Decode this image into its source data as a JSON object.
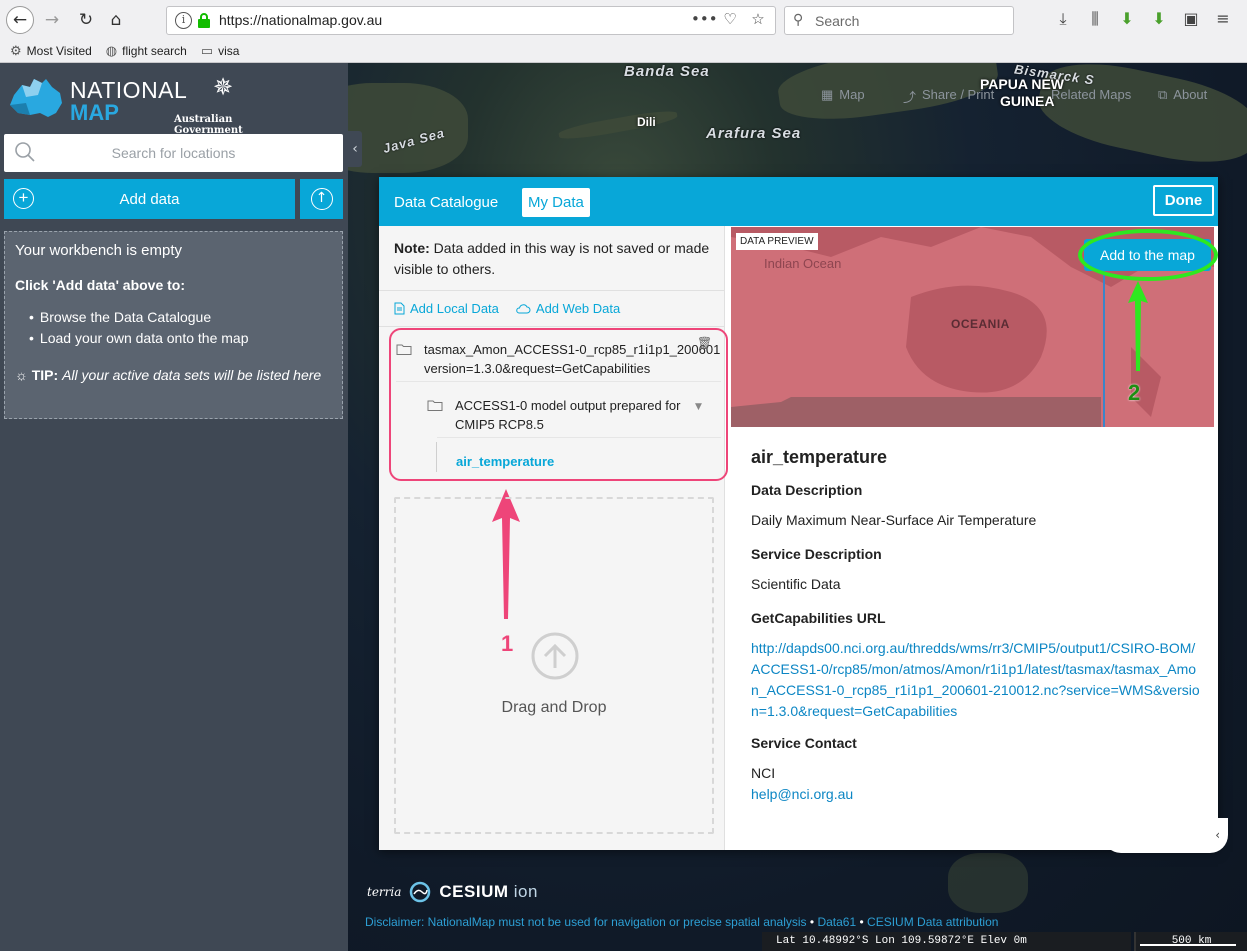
{
  "browser": {
    "url": "https://nationalmap.gov.au",
    "search_placeholder": "Search",
    "bookmarks": [
      {
        "label": "Most Visited",
        "icon": "gear-icon"
      },
      {
        "label": "flight search",
        "icon": "globe-icon"
      },
      {
        "label": "visa",
        "icon": "folder-icon"
      }
    ]
  },
  "map": {
    "labels": [
      "Banda Sea",
      "Arafura Sea",
      "Java Sea",
      "Bismarck S"
    ],
    "places": [
      "PAPUA NEW",
      "GUINEA",
      "Dili"
    ],
    "menu": [
      "Map",
      "Share / Print",
      "Related Maps",
      "About"
    ]
  },
  "workbench": {
    "logo_line1": "NATIONAL",
    "logo_line2": "MAP",
    "gov_text": "Australian Government",
    "search_placeholder": "Search for locations",
    "add_data_label": "Add data",
    "empty_title": "Your workbench is empty",
    "empty_sub": "Click 'Add data' above to:",
    "empty_items": [
      "Browse the Data Catalogue",
      "Load your own data onto the map"
    ],
    "tip_label": "TIP:",
    "tip_text": "All your active data sets will be listed here"
  },
  "modal": {
    "tab_catalogue": "Data Catalogue",
    "tab_mydata": "My Data",
    "done_label": "Done",
    "note_label": "Note:",
    "note_text": "Data added in this way is not saved or made visible to others.",
    "add_local": "Add Local Data",
    "add_web": "Add Web Data",
    "tree_root": "tasmax_Amon_ACCESS1-0_rcp85_r1i1p1_200601 version=1.3.0&request=GetCapabilities",
    "tree_child": "ACCESS1-0 model output prepared for CMIP5 RCP8.5",
    "tree_leaf": "air_temperature",
    "drop_text": "Drag and Drop",
    "annotation_1": "1",
    "annotation_2": "2",
    "preview_label": "DATA PREVIEW",
    "preview_ocean": "Indian Ocean",
    "preview_oceania": "OCEANIA",
    "add_to_map": "Add to the map",
    "details": {
      "title": "air_temperature",
      "data_desc_head": "Data Description",
      "data_desc": "Daily Maximum Near-Surface Air Temperature",
      "service_desc_head": "Service Description",
      "service_desc": "Scientific Data",
      "getcap_head": "GetCapabilities URL",
      "getcap_url": "http://dapds00.nci.org.au/thredds/wms/rr3/CMIP5/output1/CSIRO-BOM/ACCESS1-0/rcp85/mon/atmos/Amon/r1i1p1/latest/tasmax/tasmax_Amon_ACCESS1-0_rcp85_r1i1p1_200601-210012.nc?service=WMS&version=1.3.0&request=GetCapabilities",
      "contact_head": "Service Contact",
      "contact_name": "NCI",
      "contact_email": "help@nci.org.au"
    }
  },
  "footer": {
    "terria": "terria",
    "cesium": "CESIUM",
    "ion": "ion",
    "disclaimer": "Disclaimer: NationalMap must not be used for navigation or precise spatial analysis",
    "data61": "Data61",
    "cesium_link": "CESIUM",
    "attribution": "Data attribution",
    "coords": "Lat  10.48992°S  Lon  109.59872°E  Elev  0m",
    "scale": "500 km"
  },
  "colors": {
    "accent": "#08a7d8",
    "highlight_pink": "#ee4579",
    "highlight_green": "#2ee820"
  }
}
